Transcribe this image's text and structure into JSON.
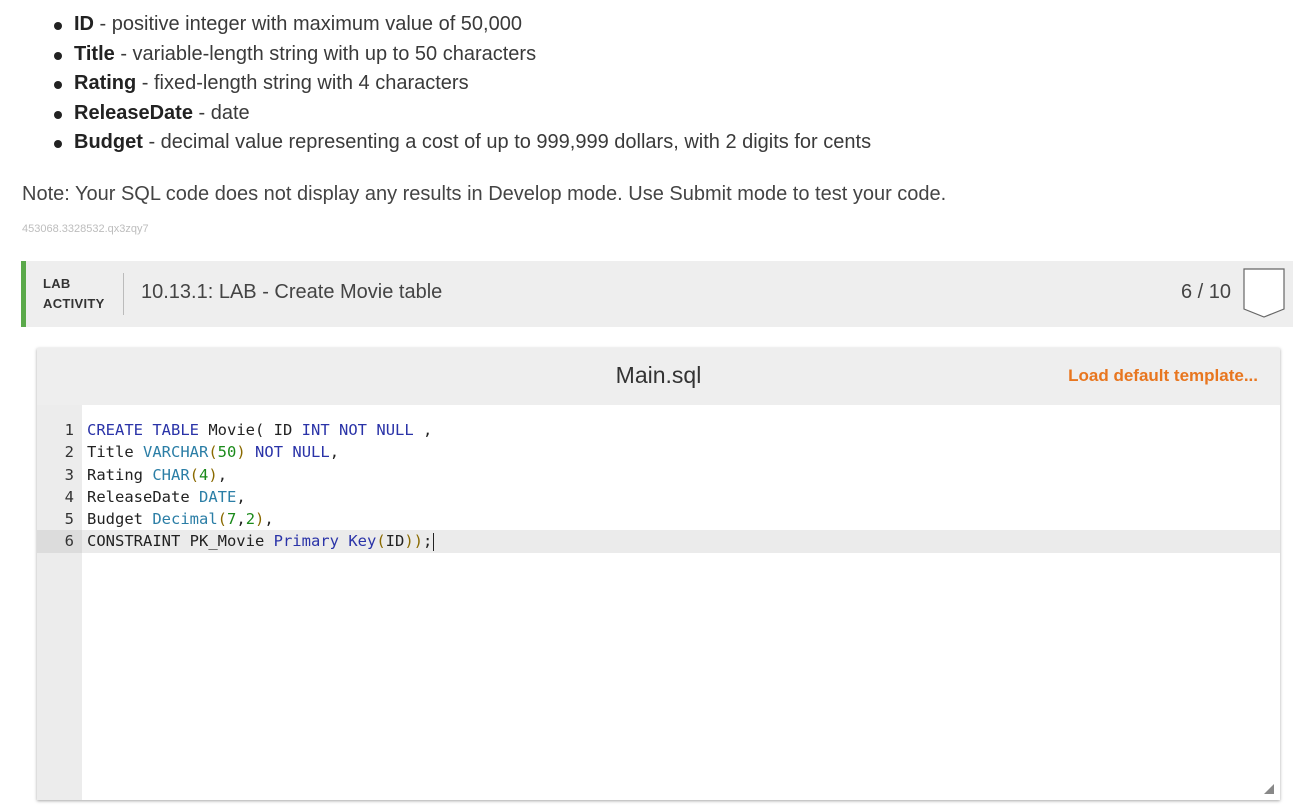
{
  "requirements": [
    {
      "term": "ID",
      "desc": " - positive integer with maximum value of 50,000"
    },
    {
      "term": "Title",
      "desc": " - variable-length string with up to 50 characters"
    },
    {
      "term": "Rating",
      "desc": " - fixed-length string with 4 characters"
    },
    {
      "term": "ReleaseDate",
      "desc": " - date"
    },
    {
      "term": "Budget",
      "desc": " - decimal value representing a cost of up to 999,999 dollars, with 2 digits for cents"
    }
  ],
  "note": "Note: Your SQL code does not display any results in Develop mode. Use Submit mode to test your code.",
  "identifier": "453068.3328532.qx3zqy7",
  "lab": {
    "tag_line1": "LAB",
    "tag_line2": "ACTIVITY",
    "title": "10.13.1: LAB - Create Movie table",
    "score": "6 / 10",
    "accent_color": "#5aa94a"
  },
  "editor": {
    "file_name": "Main.sql",
    "load_default_label": "Load default template...",
    "active_line": 6,
    "lines": [
      {
        "n": "1",
        "tokens": [
          [
            "kw",
            "CREATE"
          ],
          [
            "p",
            " "
          ],
          [
            "kw",
            "TABLE"
          ],
          [
            "p",
            " Movie( ID "
          ],
          [
            "kw",
            "INT"
          ],
          [
            "p",
            " "
          ],
          [
            "kw",
            "NOT"
          ],
          [
            "p",
            " "
          ],
          [
            "kw",
            "NULL"
          ],
          [
            "p",
            " ,"
          ]
        ]
      },
      {
        "n": "2",
        "tokens": [
          [
            "p",
            "Title "
          ],
          [
            "ty",
            "VARCHAR"
          ],
          [
            "pr",
            "("
          ],
          [
            "nm",
            "50"
          ],
          [
            "pr",
            ")"
          ],
          [
            "p",
            " "
          ],
          [
            "kw",
            "NOT"
          ],
          [
            "p",
            " "
          ],
          [
            "kw",
            "NULL"
          ],
          [
            "p",
            ","
          ]
        ]
      },
      {
        "n": "3",
        "tokens": [
          [
            "p",
            "Rating "
          ],
          [
            "ty",
            "CHAR"
          ],
          [
            "pr",
            "("
          ],
          [
            "nm",
            "4"
          ],
          [
            "pr",
            ")"
          ],
          [
            "p",
            ","
          ]
        ]
      },
      {
        "n": "4",
        "tokens": [
          [
            "p",
            "ReleaseDate "
          ],
          [
            "ty",
            "DATE"
          ],
          [
            "p",
            ","
          ]
        ]
      },
      {
        "n": "5",
        "tokens": [
          [
            "p",
            "Budget "
          ],
          [
            "ty",
            "Decimal"
          ],
          [
            "pr",
            "("
          ],
          [
            "nm",
            "7"
          ],
          [
            "p",
            ","
          ],
          [
            "nm",
            "2"
          ],
          [
            "pr",
            ")"
          ],
          [
            "p",
            ","
          ]
        ]
      },
      {
        "n": "6",
        "tokens": [
          [
            "p",
            "CONSTRAINT PK_Movie "
          ],
          [
            "kw",
            "Primary"
          ],
          [
            "p",
            " "
          ],
          [
            "kw",
            "Key"
          ],
          [
            "pr",
            "("
          ],
          [
            "p",
            "ID"
          ],
          [
            "pr",
            "))"
          ],
          [
            "p",
            ";"
          ]
        ]
      }
    ]
  }
}
